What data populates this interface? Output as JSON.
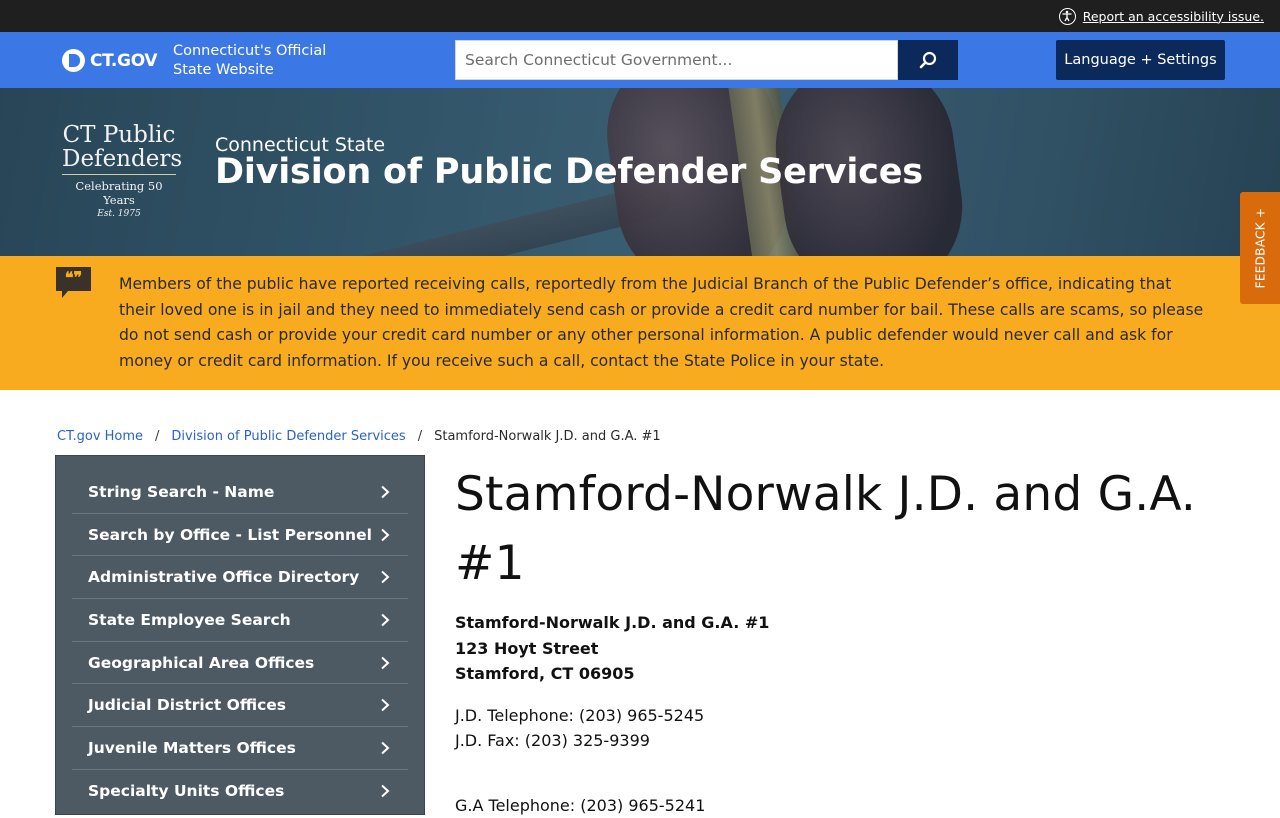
{
  "topbar": {
    "accessibility_link": "Report an accessibility issue."
  },
  "header": {
    "logo_text": "CT.GOV",
    "tagline_line1": "Connecticut's Official",
    "tagline_line2": "State Website",
    "search_placeholder": "Search Connecticut Government...",
    "language_button": "Language + Settings"
  },
  "banner": {
    "seal_line1": "CT Public",
    "seal_line2": "Defenders",
    "seal_line3": "Celebrating 50 Years",
    "seal_line4": "Est. 1975",
    "agency_subtitle": "Connecticut State",
    "agency_title": "Division of Public Defender Services"
  },
  "feedback_tab": "FEEDBACK +",
  "alert": {
    "text": "Members of the public have reported receiving calls, reportedly from the Judicial Branch of the Public Defender’s office, indicating that their loved one is in jail and they need to immediately send cash or provide a credit card number for bail. These calls are scams, so please do not send cash or provide your credit card number or any other personal information. A public defender would never call and ask for money or credit card information. If you receive such a call, contact the State Police in your state."
  },
  "breadcrumb": {
    "items": [
      "CT.gov Home",
      "Division of Public Defender Services"
    ],
    "current": "Stamford-Norwalk J.D. and G.A. #1"
  },
  "sidebar": {
    "items": [
      {
        "label": "String Search - Name"
      },
      {
        "label": "Search by Office - List Personnel"
      },
      {
        "label": "Administrative Office Directory"
      },
      {
        "label": "State Employee Search"
      },
      {
        "label": "Geographical Area Offices"
      },
      {
        "label": "Judicial District Offices"
      },
      {
        "label": "Juvenile Matters Offices"
      },
      {
        "label": "Specialty Units Offices"
      }
    ]
  },
  "main": {
    "title": "Stamford-Norwalk J.D. and G.A. #1",
    "address": {
      "name": "Stamford-Norwalk J.D. and G.A. #1",
      "street": "123 Hoyt Street",
      "city": "Stamford, CT 06905"
    },
    "jd_phone": "J.D. Telephone: (203) 965-5245",
    "jd_fax": "J.D. Fax: (203) 325-9399",
    "ga_phone": "G.A Telephone: (203) 965-5241"
  },
  "colors": {
    "header_blue": "#3c77e6",
    "navy": "#0b2a5b",
    "alert_orange": "#f8ab1f",
    "feedback_orange": "#d96b0c",
    "sidebar_gray": "#4d5a64",
    "link_blue": "#2b62c4"
  },
  "icons": {
    "accessibility": "accessibility-icon",
    "search": "search-icon",
    "alert": "quote-bubble-icon",
    "chevron": "chevron-right-icon"
  }
}
